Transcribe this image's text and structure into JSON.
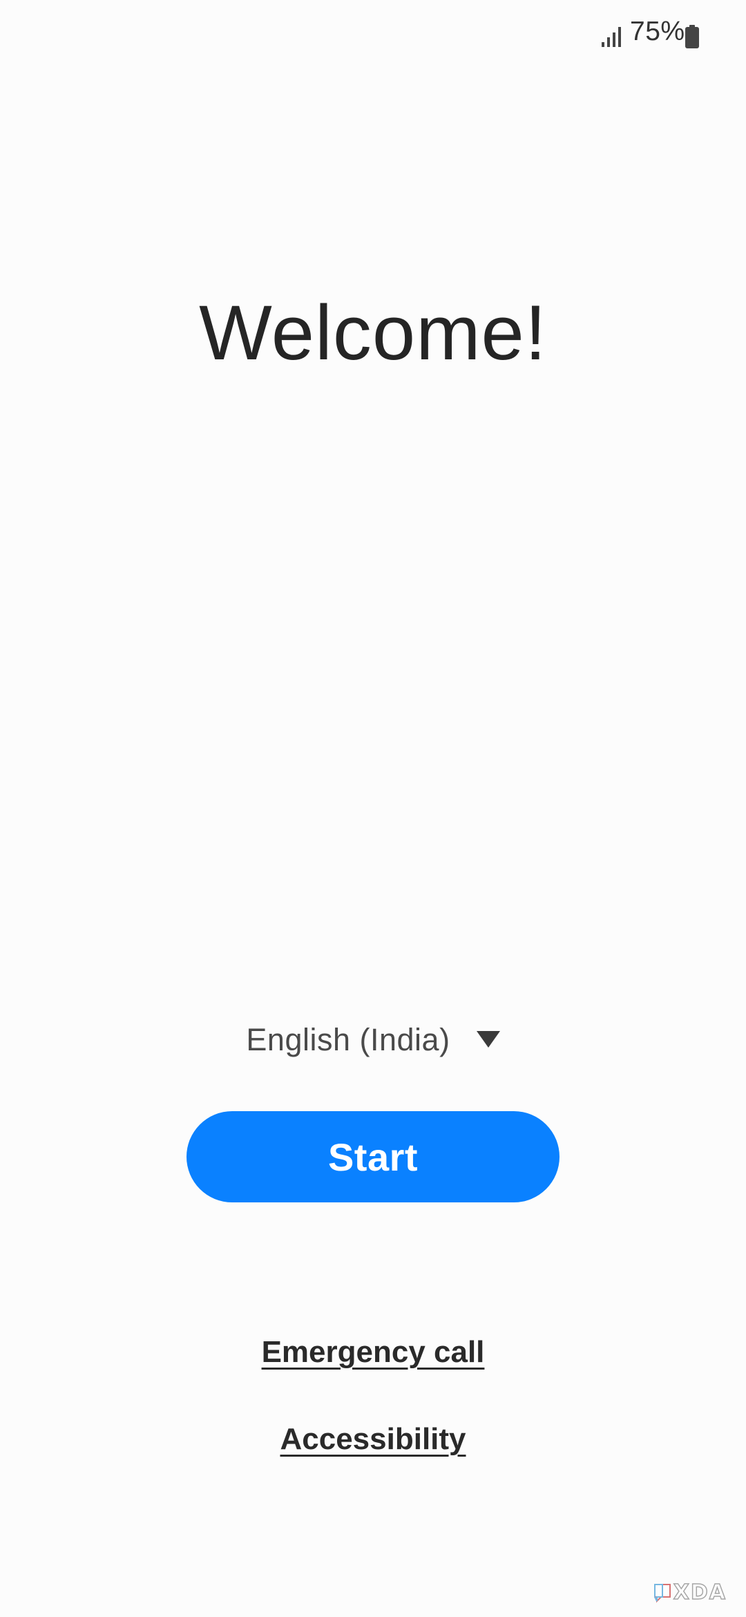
{
  "status_bar": {
    "battery_percent": "75%",
    "signal_icon": "signal-icon",
    "battery_icon": "battery-icon",
    "battery_level": 0.75
  },
  "welcome": {
    "title": "Welcome!"
  },
  "language": {
    "selected": "English (India)",
    "icon": "dropdown-triangle-icon"
  },
  "start_button": {
    "label": "Start",
    "color": "#0a81ff"
  },
  "links": {
    "emergency_call": "Emergency call",
    "accessibility": "Accessibility"
  },
  "watermark": {
    "text": "XDA"
  }
}
